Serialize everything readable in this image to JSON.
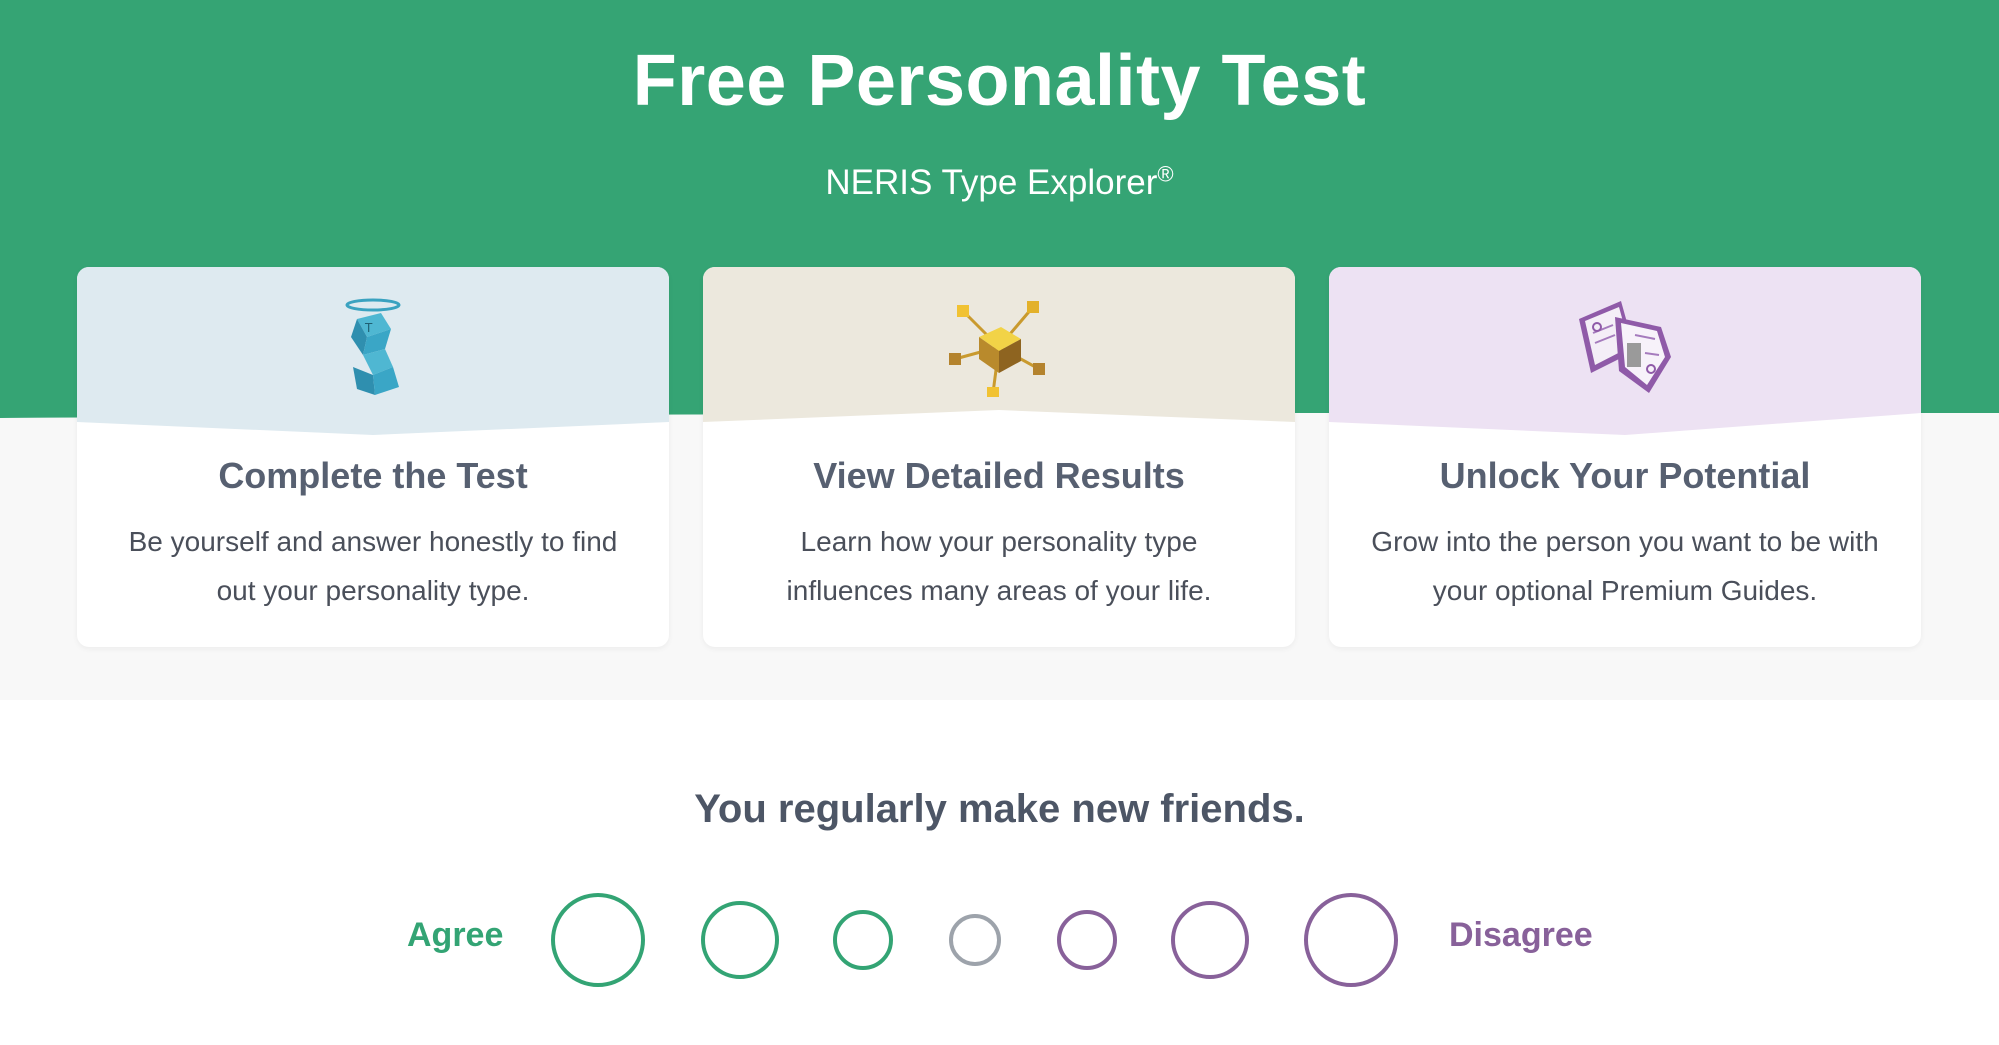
{
  "colors": {
    "brand_green": "#33a474",
    "brand_purple": "#88619a",
    "neutral_gray": "#9da3ab",
    "band_gray": "#f8f8f8"
  },
  "hero": {
    "title": "Free Personality Test",
    "subtitle": "NERIS Type Explorer",
    "subtitle_mark": "®"
  },
  "cards": [
    {
      "title": "Complete the Test",
      "description": "Be yourself and answer honestly to find out your personality type.",
      "illustration": "cube-figure-with-halo-icon",
      "bg": "#deeaf0"
    },
    {
      "title": "View Detailed Results",
      "description": "Learn how your personality type influences many areas of your life.",
      "illustration": "golden-cubes-network-icon",
      "bg": "#ece8dd"
    },
    {
      "title": "Unlock Your Potential",
      "description": "Grow into the person you want to be with your optional Premium Guides.",
      "illustration": "purple-guide-papers-icon",
      "bg": "#ede2f3"
    }
  ],
  "question": {
    "text": "You regularly make new friends.",
    "agree_label": "Agree",
    "disagree_label": "Disagree",
    "options": 7
  }
}
